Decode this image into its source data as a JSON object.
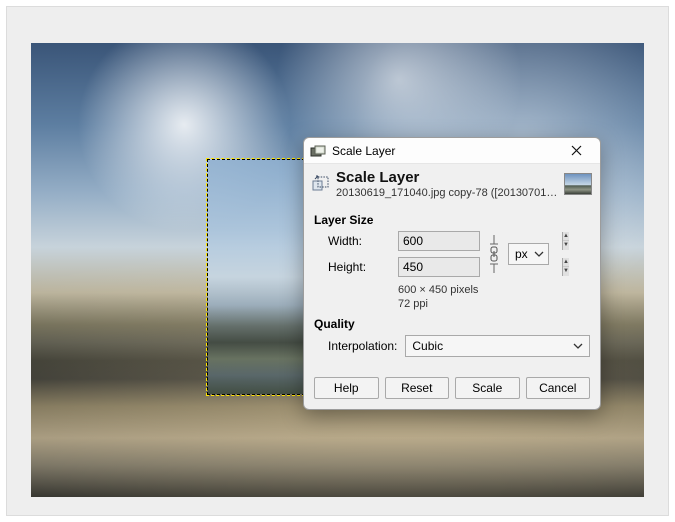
{
  "window": {
    "title": "Scale Layer"
  },
  "header": {
    "title": "Scale Layer",
    "subtitle": "20130619_171040.jpg copy-78 ([20130701_..."
  },
  "layer_size": {
    "section_label": "Layer Size",
    "width_label": "Width:",
    "height_label": "Height:",
    "width_value": "600",
    "height_value": "450",
    "unit_value": "px",
    "dimensions_text": "600 × 450 pixels",
    "resolution_text": "72 ppi"
  },
  "quality": {
    "section_label": "Quality",
    "interp_label": "Interpolation:",
    "interp_value": "Cubic"
  },
  "buttons": {
    "help": "Help",
    "reset": "Reset",
    "scale": "Scale",
    "cancel": "Cancel"
  }
}
